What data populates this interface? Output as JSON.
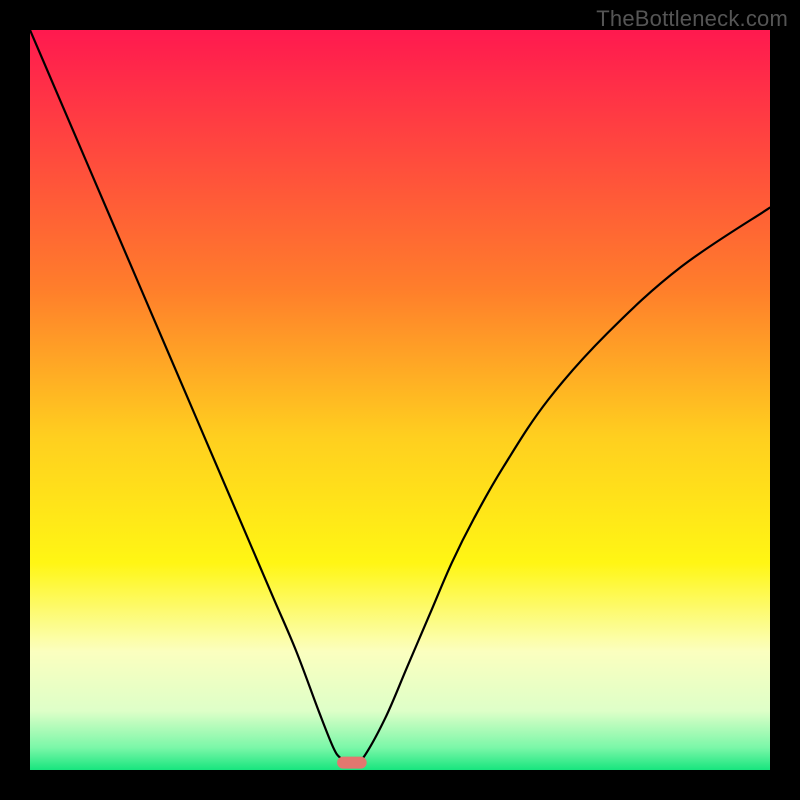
{
  "watermark": "TheBottleneck.com",
  "chart_data": {
    "type": "line",
    "title": "",
    "xlabel": "",
    "ylabel": "",
    "xlim": [
      0,
      100
    ],
    "ylim": [
      0,
      100
    ],
    "grid": false,
    "background_gradient": {
      "stops": [
        {
          "offset": 0.0,
          "color": "#ff194f"
        },
        {
          "offset": 0.35,
          "color": "#ff7e2b"
        },
        {
          "offset": 0.55,
          "color": "#ffcf1f"
        },
        {
          "offset": 0.72,
          "color": "#fff614"
        },
        {
          "offset": 0.84,
          "color": "#fbffbf"
        },
        {
          "offset": 0.92,
          "color": "#deffc8"
        },
        {
          "offset": 0.97,
          "color": "#7af7a8"
        },
        {
          "offset": 1.0,
          "color": "#18e57e"
        }
      ]
    },
    "series": [
      {
        "name": "curve",
        "x": [
          0,
          3,
          6,
          9,
          12,
          15,
          18,
          21,
          24,
          27,
          30,
          33,
          36,
          39,
          41,
          42,
          43,
          44,
          45,
          48,
          51,
          54,
          57,
          60,
          64,
          70,
          78,
          88,
          100
        ],
        "values": [
          100,
          93,
          86,
          79,
          72,
          65,
          58,
          51,
          44,
          37,
          30,
          23,
          16,
          8,
          3,
          1.6,
          1.2,
          1.2,
          1.6,
          7,
          14,
          21,
          28,
          34,
          41,
          50,
          59,
          68,
          76
        ]
      }
    ],
    "marker": {
      "name": "min-marker",
      "x_range": [
        41.5,
        45.5
      ],
      "y": 1.0,
      "color": "#e2776f"
    }
  }
}
